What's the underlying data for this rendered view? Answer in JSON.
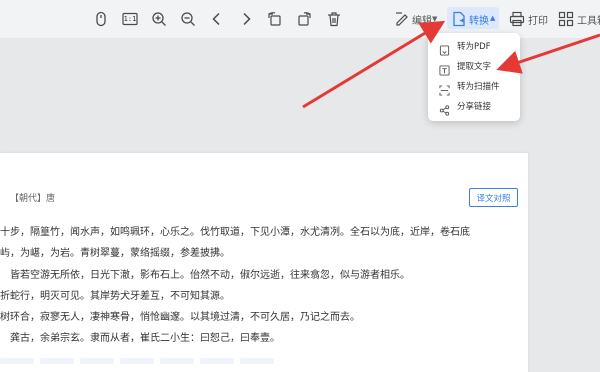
{
  "toolbar": {
    "icons": [
      "mouse-icon",
      "actual-size-icon",
      "zoom-in-icon",
      "zoom-out-icon",
      "prev-page-icon",
      "next-page-icon",
      "rotate-left-icon",
      "rotate-right-icon",
      "delete-icon"
    ],
    "actual_size_label": "1:1",
    "edit_label": "编辑",
    "convert_label": "转换",
    "print_label": "打印",
    "toolbox_label": "工具箱"
  },
  "convert_menu": {
    "items": [
      {
        "label": "转为PDF",
        "icon": "pdf-convert-icon"
      },
      {
        "label": "提取文字",
        "icon": "ocr-text-icon"
      },
      {
        "label": "转为扫描件",
        "icon": "scan-icon"
      },
      {
        "label": "分享链接",
        "icon": "share-icon"
      }
    ]
  },
  "document": {
    "era": "【朝代】唐",
    "compare_button": "译文对照",
    "lines": [
      "十步，隔篁竹，闻水声，如鸣珮环，心乐之。伐竹取道，下见小潭，水尤清冽。全石以为底，近岸，卷石底",
      "屿，为嵁，为岩。青树翠蔓，蒙络摇缀，参差披拂。",
      "皆若空游无所依，日光下澈，影布石上。佁然不动，俶尔远逝，往来翕忽，似与游者相乐。",
      "折蛇行，明灭可见。其岸势犬牙差互，不可知其源。",
      "树环合，寂寥无人，凄神寒骨，悄怆幽邃。以其境过清，不可久居，乃记之而去。",
      "龚古，余弟宗玄。隶而从者，崔氏二小生：曰恕己，曰奉壹。"
    ]
  },
  "colors": {
    "accent": "#3c7fe2",
    "arrow": "#e53935",
    "toolbar_bg": "#f2f3f5",
    "active_bg": "#dce8fb"
  }
}
